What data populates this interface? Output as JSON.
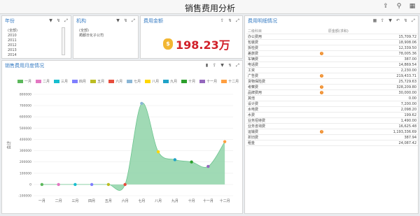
{
  "app": {
    "title": "销售费用分析"
  },
  "titlebar_icons": [
    "export-icon",
    "filter-icon",
    "calendar-icon"
  ],
  "year_panel": {
    "title": "年份",
    "items": [
      "(全部)",
      "2010",
      "2011",
      "2012",
      "2013",
      "2014"
    ]
  },
  "org_panel": {
    "title": "机构",
    "items": [
      "(全部)",
      "蔺鄱日化子公司"
    ]
  },
  "amount_panel": {
    "title": "费用金额",
    "value": "198.23万"
  },
  "chart_panel": {
    "title": "销售费用月度情况"
  },
  "detail_panel": {
    "title": "费用明细情况",
    "col_item": "二级科目",
    "col_amount": "原金额(求和)",
    "rows": [
      {
        "name": "办公费用",
        "amount": "15,709.72",
        "warn": false
      },
      {
        "name": "包装费",
        "amount": "18,908.06",
        "warn": false
      },
      {
        "name": "拆检费",
        "amount": "12,339.50",
        "warn": false
      },
      {
        "name": "差旅费",
        "amount": "78,005.36",
        "warn": true
      },
      {
        "name": "车辆费",
        "amount": "387.00",
        "warn": false
      },
      {
        "name": "电话费",
        "amount": "14,869.54",
        "warn": false
      },
      {
        "name": "工资",
        "amount": "2,230.00",
        "warn": false
      },
      {
        "name": "广告费",
        "amount": "219,433.71",
        "warn": true
      },
      {
        "name": "货物保险费",
        "amount": "25,729.63",
        "warn": false
      },
      {
        "name": "考察费",
        "amount": "328,209.80",
        "warn": true
      },
      {
        "name": "品牌费用",
        "amount": "30,000.00",
        "warn": true
      },
      {
        "name": "其他",
        "amount": "0.00",
        "warn": false
      },
      {
        "name": "设计费",
        "amount": "7,200.00",
        "warn": false
      },
      {
        "name": "水电费",
        "amount": "2,098.20",
        "warn": false
      },
      {
        "name": "水费",
        "amount": "199.62",
        "warn": false
      },
      {
        "name": "业务招待费",
        "amount": "1,490.00",
        "warn": false
      },
      {
        "name": "业务咨询费",
        "amount": "16,625.48",
        "warn": false
      },
      {
        "name": "运输费",
        "amount": "1,193,336.69",
        "warn": true
      },
      {
        "name": "折旧费",
        "amount": "387.94",
        "warn": false
      },
      {
        "name": "租金",
        "amount": "24,087.42",
        "warn": false
      }
    ]
  },
  "chart_data": {
    "type": "area",
    "categories": [
      "一月",
      "二月",
      "三月",
      "四月",
      "五月",
      "六月",
      "七月",
      "八月",
      "九月",
      "十月",
      "十一月",
      "十二月"
    ],
    "values": [
      0,
      0,
      0,
      0,
      0,
      0,
      720000,
      290000,
      220000,
      200000,
      160000,
      380000
    ],
    "ylabel": "合计",
    "ylim": [
      -100000,
      800000
    ],
    "yticks": [
      -100000,
      0,
      100000,
      200000,
      300000,
      400000,
      500000,
      600000,
      700000,
      800000
    ],
    "fill_color": "#8fd3a8",
    "point_colors": [
      "#5cb85c",
      "#e377c2",
      "#17becf",
      "#7f7fff",
      "#bcbd22",
      "#e74c3c",
      "#8ab6d6",
      "#ffd700",
      "#1fa3c8",
      "#2ca02c",
      "#9467bd",
      "#ff9f40"
    ],
    "grid": true,
    "legend_position": "top"
  }
}
